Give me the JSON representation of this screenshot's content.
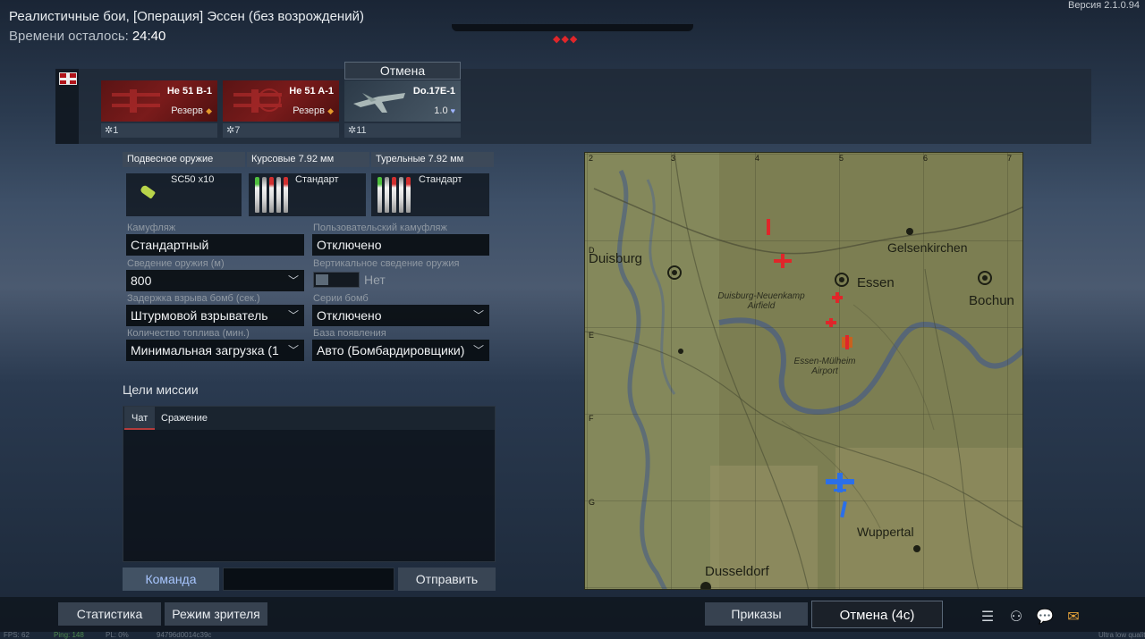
{
  "header": {
    "mission_title": "Реалистичные бои, [Операция] Эссен (без возрождений)",
    "time_left_label": "Времени осталось:",
    "time_left_value": "24:40",
    "version": "Версия 2.1.0.94",
    "markers": "◆◆◆"
  },
  "vehicles": [
    {
      "name": "He 51 B-1",
      "status": "Резерв",
      "crew": "1"
    },
    {
      "name": "He 51 A-1",
      "status": "Резерв",
      "crew": "7"
    },
    {
      "name": "Do.17E-1",
      "status": "1.0",
      "crew": "11"
    }
  ],
  "cancel_tab": "Отмена",
  "weapons": {
    "suspended": {
      "header": "Подвесное оружие",
      "value": "SC50 x10"
    },
    "course": {
      "header": "Курсовые 7.92 мм",
      "value": "Стандарт"
    },
    "turret": {
      "header": "Турельные 7.92 мм",
      "value": "Стандарт"
    }
  },
  "settings": {
    "camouflage": {
      "label": "Камуфляж",
      "value": "Стандартный"
    },
    "user_camo": {
      "label": "Пользовательский камуфляж",
      "value": "Отключено"
    },
    "convergence": {
      "label": "Сведение оружия (м)",
      "value": "800"
    },
    "vertical_convergence": {
      "label": "Вертикальное сведение оружия",
      "value": "Нет"
    },
    "bomb_delay": {
      "label": "Задержка взрыва бомб (сек.)",
      "value": "Штурмовой взрыватель"
    },
    "bomb_series": {
      "label": "Серии бомб",
      "value": "Отключено"
    },
    "fuel": {
      "label": "Количество топлива (мин.)",
      "value": "Минимальная загрузка (1"
    },
    "spawn_base": {
      "label": "База появления",
      "value": "Авто (Бомбардировщики)"
    }
  },
  "mission": {
    "goals_label": "Цели миссии"
  },
  "chat": {
    "tab_chat": "Чат",
    "tab_battle": "Сражение",
    "team_button": "Команда",
    "send_button": "Отправить"
  },
  "map": {
    "cities": {
      "duisburg": "Duisburg",
      "essen": "Essen",
      "gelsenkirchen": "Gelsenkirchen",
      "bochum": "Bochun",
      "wuppertal": "Wuppertal",
      "dusseldorf": "Dusseldorf",
      "airfield1": "Duisburg-Neuenkamp Airfield",
      "airfield2": "Essen-Mülheim Airport"
    },
    "grid_numbers": [
      "2",
      "3",
      "4",
      "5",
      "6",
      "7"
    ],
    "grid_letters": [
      "D",
      "E",
      "F",
      "G"
    ]
  },
  "bottom": {
    "stats": "Статистика",
    "spectator": "Режим зрителя",
    "orders": "Приказы",
    "cancel_main": "Отмена (4с)"
  },
  "footer": {
    "fps": "FPS: 62",
    "ping": "Ping: 148",
    "pl": "PL: 0%",
    "session": "94796d0014c39c",
    "quality": "Ultra low quality"
  },
  "colors": {
    "enemy": "#e0262a",
    "ally": "#2b6fe8",
    "reserve_dot": "#e39a2b",
    "team_button_text": "#a8c6ff"
  }
}
